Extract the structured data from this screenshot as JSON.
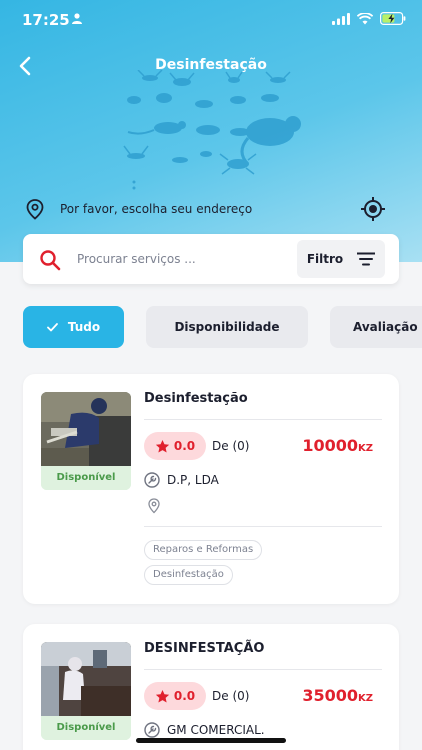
{
  "status_bar": {
    "time": "17:25"
  },
  "header": {
    "title": "Desinfestação"
  },
  "address": {
    "text": "Por favor, escolha seu endereço"
  },
  "search": {
    "placeholder": "Procurar serviços ...",
    "filter_label": "Filtro"
  },
  "filters": [
    {
      "label": "Tudo",
      "selected": true
    },
    {
      "label": "Disponibilidade",
      "selected": false
    },
    {
      "label": "Avaliação",
      "selected": false
    }
  ],
  "services": [
    {
      "name": "Desinfestação",
      "availability": "Disponível",
      "rating": "0.0",
      "reviews": "De (0)",
      "price": "10000",
      "currency": "KZ",
      "company": "D.P, LDA",
      "tags": [
        "Reparos e Reformas",
        "Desinfestação"
      ]
    },
    {
      "name": "DESINFESTAÇÃO",
      "availability": "Disponível",
      "rating": "0.0",
      "reviews": "De (0)",
      "price": "35000",
      "currency": "KZ",
      "company": "GM COMERCIAL."
    }
  ],
  "colors": {
    "accent": "#29b4e5",
    "price_red": "#e0202d",
    "available_green": "#4a9a4a"
  }
}
